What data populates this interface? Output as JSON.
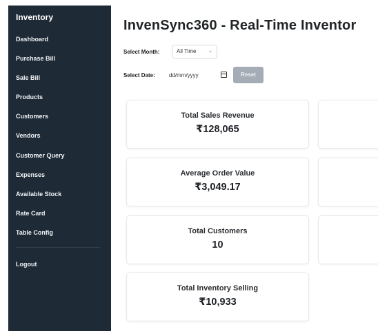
{
  "sidebar": {
    "brand": "Inventory",
    "items": [
      {
        "label": "Dashboard"
      },
      {
        "label": "Purchase Bill"
      },
      {
        "label": "Sale Bill"
      },
      {
        "label": "Products"
      },
      {
        "label": "Customers"
      },
      {
        "label": "Vendors"
      },
      {
        "label": "Customer Query"
      },
      {
        "label": "Expenses"
      },
      {
        "label": "Available Stock"
      },
      {
        "label": "Rate Card"
      },
      {
        "label": "Table Config"
      }
    ],
    "logout_label": "Logout"
  },
  "header": {
    "title": "InvenSync360 - Real-Time Inventor"
  },
  "filters": {
    "month_label": "Select Month:",
    "month_value": "All Time",
    "date_label": "Select Date:",
    "date_placeholder": "dd/mm/yyyy",
    "reset_label": "Reset"
  },
  "cards": [
    {
      "title": "Total Sales Revenue",
      "value": "₹128,065"
    },
    {
      "title": "Average Order Value",
      "value": "₹3,049.17"
    },
    {
      "title": "Total Customers",
      "value": "10"
    },
    {
      "title": "Total Inventory Selling",
      "value": "₹10,933"
    }
  ],
  "colors": {
    "sidebar_bg": "#1e2a36",
    "reset_button_bg": "#a4acb6"
  }
}
